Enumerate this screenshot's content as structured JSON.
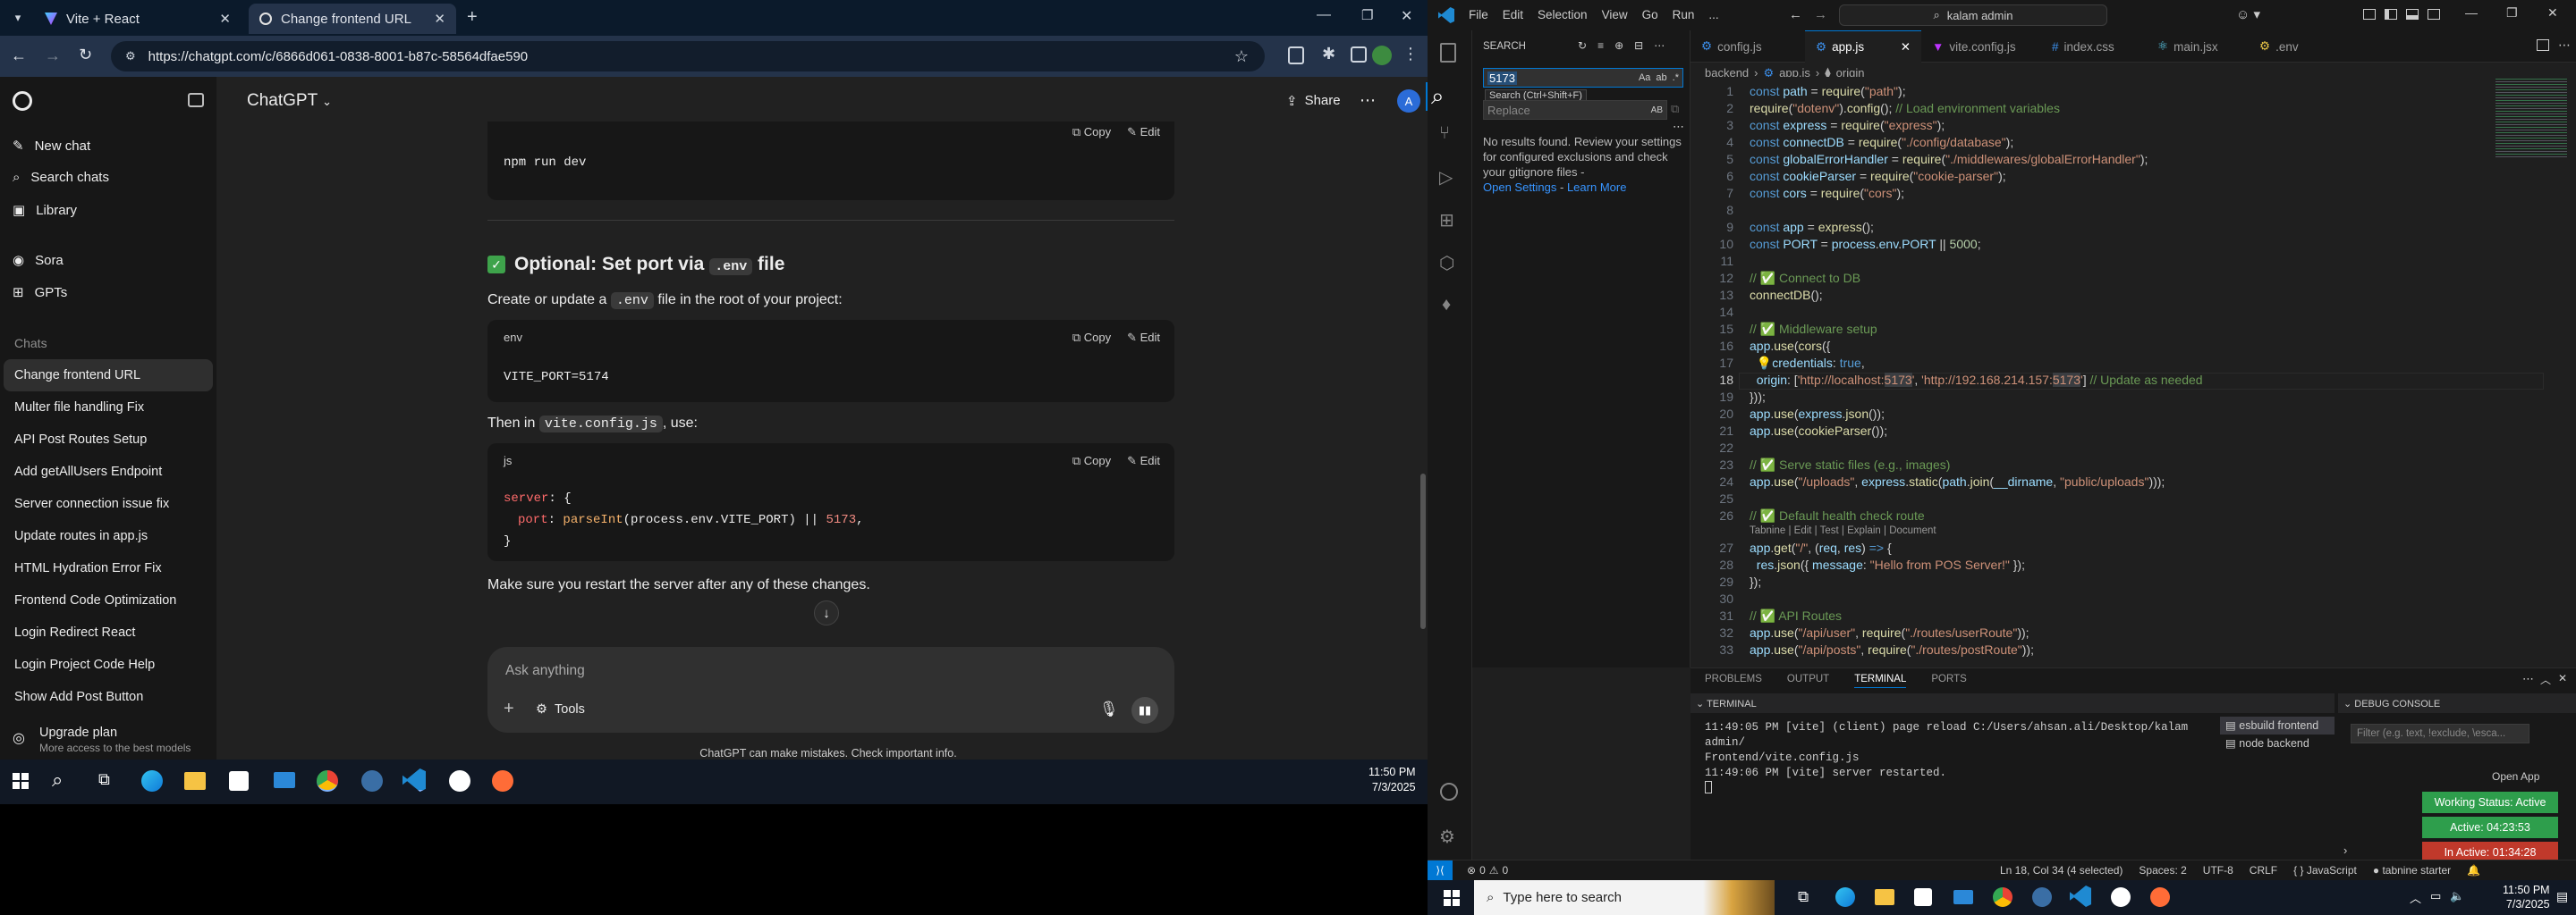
{
  "browser": {
    "tabs": [
      {
        "title": "Vite + React"
      },
      {
        "title": "Change frontend URL"
      }
    ],
    "url": "https://chatgpt.com/c/6866d061-0838-8001-b87c-58564dfae590"
  },
  "chatgpt": {
    "sidebar": {
      "new_chat": "New chat",
      "search_chats": "Search chats",
      "library": "Library",
      "sora": "Sora",
      "gpts": "GPTs",
      "chats_heading": "Chats",
      "chats": [
        "Change frontend URL",
        "Multer file handling Fix",
        "API Post Routes Setup",
        "Add getAllUsers Endpoint",
        "Server connection issue fix",
        "Update routes in app.js",
        "HTML Hydration Error Fix",
        "Frontend Code Optimization",
        "Login Redirect React",
        "Login Project Code Help",
        "Show Add Post Button"
      ],
      "upgrade_title": "Upgrade plan",
      "upgrade_sub": "More access to the best models"
    },
    "header": {
      "model": "ChatGPT",
      "share": "Share",
      "avatar": "A"
    },
    "content": {
      "code1": {
        "lang": "",
        "line": "npm run dev"
      },
      "copy": "Copy",
      "edit": "Edit",
      "heading_pre": "Optional: Set port via ",
      "heading_code": ".env",
      "heading_post": " file",
      "p1_pre": "Create or update a ",
      "p1_code": ".env",
      "p1_post": " file in the root of your project:",
      "code2": {
        "lang": "env",
        "line": "VITE_PORT=5174"
      },
      "p2_pre": "Then in ",
      "p2_code": "vite.config.js",
      "p2_post": ", use:",
      "code3": {
        "lang": "js",
        "l1a": "server",
        "l1b": ": {",
        "l2a": "port",
        "l2b": ": ",
        "l2c": "parseInt",
        "l2d": "(process.env.VITE_PORT) || ",
        "l2e": "5173",
        "l2f": ",",
        "l3": "}"
      },
      "p3": "Make sure you restart the server after any of these changes."
    },
    "composer": {
      "placeholder": "Ask anything",
      "tools": "Tools"
    },
    "disclaimer": "ChatGPT can make mistakes. Check important info."
  },
  "taskbar_left": {
    "time": "11:50 PM",
    "date": "7/3/2025"
  },
  "vscode": {
    "menu": [
      "File",
      "Edit",
      "Selection",
      "View",
      "Go",
      "Run",
      "..."
    ],
    "command_center": "kalam admin",
    "search": {
      "title": "SEARCH",
      "query": "5173",
      "tooltip": "Search (Ctrl+Shift+F)",
      "replace_placeholder": "Replace",
      "message": "No results found. Review your settings for configured exclusions and check your gitignore files -",
      "open_settings": "Open Settings",
      "learn_more": "Learn More"
    },
    "tabs": [
      "config.js",
      "app.js",
      "vite.config.js",
      "index.css",
      "main.jsx",
      ".env"
    ],
    "breadcrumb": [
      "backend",
      "app.js",
      "origin"
    ],
    "codelens": "Tabnine | Edit | Test | Explain | Document",
    "panel": {
      "tabs": [
        "PROBLEMS",
        "OUTPUT",
        "TERMINAL",
        "PORTS"
      ],
      "terminal_title": "TERMINAL",
      "debug_title": "DEBUG CONSOLE",
      "terminal_lines": [
        "11:49:05 PM [vite] (client) page reload C:/Users/ahsan.ali/Desktop/kalam admin/",
        "Frontend/vite.config.js",
        "11:49:06 PM [vite] server restarted."
      ],
      "terminal_list": [
        "esbuild frontend",
        "node backend"
      ],
      "filter_placeholder": "Filter (e.g. text, !exclude, \\esca...",
      "open_app": "Open App",
      "working": "Working Status: Active",
      "active": "Active: 04:23:53",
      "inactive": "In Active: 01:34:28"
    },
    "status": {
      "errors": "0",
      "warnings": "0",
      "position": "Ln 18, Col 34 (4 selected)",
      "spaces": "Spaces: 2",
      "encoding": "UTF-8",
      "eol": "CRLF",
      "language": "JavaScript",
      "tabnine": "tabnine starter"
    }
  },
  "taskbar_right": {
    "search": "Type here to search",
    "time": "11:50 PM",
    "date": "7/3/2025"
  },
  "colors": {
    "vscode_accent": "#0078d4",
    "working": "#2e9e4c",
    "inactive": "#c0392b",
    "chatgpt_bg": "#212121"
  }
}
